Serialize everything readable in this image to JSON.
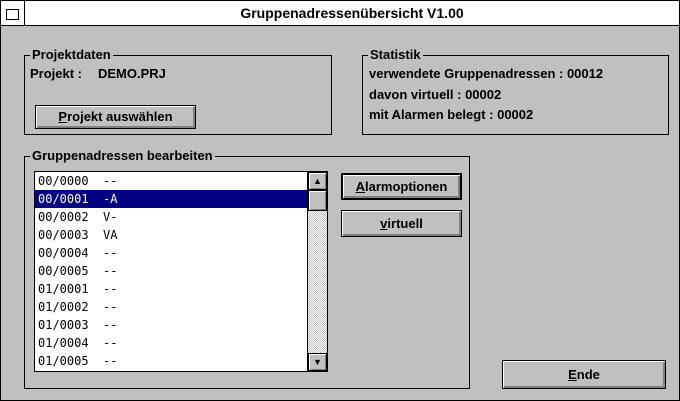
{
  "window": {
    "title": "Gruppenadressenübersicht V1.00"
  },
  "projekt": {
    "group_label": "Projektdaten",
    "projekt_label": "Projekt :",
    "projekt_value": "DEMO.PRJ",
    "select_button": {
      "mnemonic": "P",
      "rest": "rojekt auswählen"
    }
  },
  "statistik": {
    "group_label": "Statistik",
    "line1": "verwendete Gruppenadressen : 00012",
    "line2": "davon virtuell : 00002",
    "line3": "mit Alarmen belegt : 00002"
  },
  "edit": {
    "group_label": "Gruppenadressen bearbeiten",
    "selected_index": 1,
    "items": [
      "00/0000  --",
      "00/0001  -A",
      "00/0002  V-",
      "00/0003  VA",
      "00/0004  --",
      "00/0005  --",
      "01/0001  --",
      "01/0002  --",
      "01/0003  --",
      "01/0004  --",
      "01/0005  --"
    ],
    "scroll_up": "▲",
    "scroll_down": "▼"
  },
  "buttons": {
    "alarm": {
      "mnemonic": "A",
      "rest": "larmoptionen"
    },
    "virtuell": {
      "mnemonic": "v",
      "rest": "irtuell"
    },
    "ende": {
      "mnemonic": "E",
      "rest": "nde"
    }
  },
  "colors": {
    "selection": "#000080",
    "face": "#c0c0c0"
  }
}
